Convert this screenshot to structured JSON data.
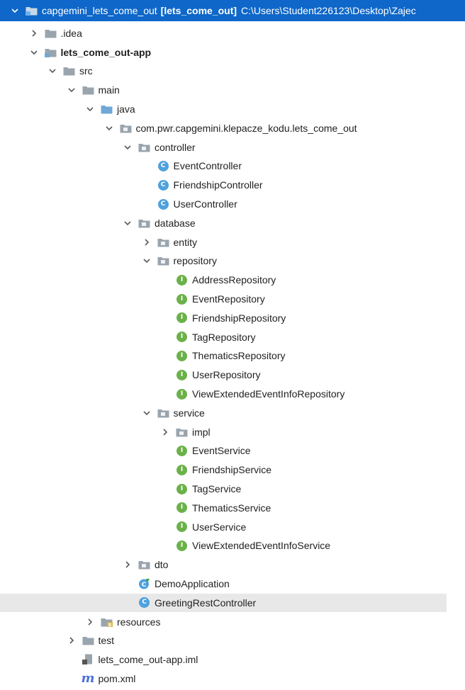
{
  "colors": {
    "selection": "#0e67c9",
    "folder": "#9aa4ad",
    "source_folder": "#6fa8d8",
    "class_badge": "#4ea1de",
    "interface_badge": "#6bb149",
    "maven": "#4a72d8"
  },
  "tree": [
    {
      "label": "capgemini_lets_come_out",
      "extra": "[lets_come_out]",
      "path": "C:\\Users\\Student226123\\Desktop\\Zajec",
      "icon": "project-module-icon",
      "chevron": "expanded",
      "depth": 0,
      "selected": true,
      "bold": false,
      "name": "tree-item-capgemini-lets-come-out"
    },
    {
      "label": ".idea",
      "icon": "folder-icon",
      "chevron": "collapsed",
      "depth": 1,
      "name": "tree-item-idea"
    },
    {
      "label": "lets_come_out-app",
      "icon": "module-folder-icon",
      "chevron": "expanded",
      "depth": 1,
      "bold": true,
      "name": "tree-item-lets-come-out-app"
    },
    {
      "label": "src",
      "icon": "folder-icon",
      "chevron": "expanded",
      "depth": 2,
      "name": "tree-item-src"
    },
    {
      "label": "main",
      "icon": "folder-icon",
      "chevron": "expanded",
      "depth": 3,
      "name": "tree-item-main"
    },
    {
      "label": "java",
      "icon": "source-folder-icon",
      "chevron": "expanded",
      "depth": 4,
      "name": "tree-item-java"
    },
    {
      "label": "com.pwr.capgemini.klepacze_kodu.lets_come_out",
      "icon": "package-icon",
      "chevron": "expanded",
      "depth": 5,
      "name": "tree-item-root-package"
    },
    {
      "label": "controller",
      "icon": "package-icon",
      "chevron": "expanded",
      "depth": 6,
      "name": "tree-item-controller"
    },
    {
      "label": "EventController",
      "icon": "class-icon",
      "chevron": "none",
      "depth": 7,
      "name": "tree-item-event-controller"
    },
    {
      "label": "FriendshipController",
      "icon": "class-icon",
      "chevron": "none",
      "depth": 7,
      "name": "tree-item-friendship-controller"
    },
    {
      "label": "UserController",
      "icon": "class-icon",
      "chevron": "none",
      "depth": 7,
      "name": "tree-item-user-controller"
    },
    {
      "label": "database",
      "icon": "package-icon",
      "chevron": "expanded",
      "depth": 6,
      "name": "tree-item-database"
    },
    {
      "label": "entity",
      "icon": "package-icon",
      "chevron": "collapsed",
      "depth": 7,
      "name": "tree-item-entity"
    },
    {
      "label": "repository",
      "icon": "package-icon",
      "chevron": "expanded",
      "depth": 7,
      "name": "tree-item-repository"
    },
    {
      "label": "AddressRepository",
      "icon": "interface-icon",
      "chevron": "none",
      "depth": 8,
      "name": "tree-item-address-repository"
    },
    {
      "label": "EventRepository",
      "icon": "interface-icon",
      "chevron": "none",
      "depth": 8,
      "name": "tree-item-event-repository"
    },
    {
      "label": "FriendshipRepository",
      "icon": "interface-icon",
      "chevron": "none",
      "depth": 8,
      "name": "tree-item-friendship-repository"
    },
    {
      "label": "TagRepository",
      "icon": "interface-icon",
      "chevron": "none",
      "depth": 8,
      "name": "tree-item-tag-repository"
    },
    {
      "label": "ThematicsRepository",
      "icon": "interface-icon",
      "chevron": "none",
      "depth": 8,
      "name": "tree-item-thematics-repository"
    },
    {
      "label": "UserRepository",
      "icon": "interface-icon",
      "chevron": "none",
      "depth": 8,
      "name": "tree-item-user-repository"
    },
    {
      "label": "ViewExtendedEventInfoRepository",
      "icon": "interface-icon",
      "chevron": "none",
      "depth": 8,
      "name": "tree-item-view-extended-event-info-repository"
    },
    {
      "label": "service",
      "icon": "package-icon",
      "chevron": "expanded",
      "depth": 7,
      "name": "tree-item-service"
    },
    {
      "label": "impl",
      "icon": "package-icon",
      "chevron": "collapsed",
      "depth": 8,
      "name": "tree-item-impl"
    },
    {
      "label": "EventService",
      "icon": "interface-icon",
      "chevron": "none",
      "depth": 8,
      "name": "tree-item-event-service"
    },
    {
      "label": "FriendshipService",
      "icon": "interface-icon",
      "chevron": "none",
      "depth": 8,
      "name": "tree-item-friendship-service"
    },
    {
      "label": "TagService",
      "icon": "interface-icon",
      "chevron": "none",
      "depth": 8,
      "name": "tree-item-tag-service"
    },
    {
      "label": "ThematicsService",
      "icon": "interface-icon",
      "chevron": "none",
      "depth": 8,
      "name": "tree-item-thematics-service"
    },
    {
      "label": "UserService",
      "icon": "interface-icon",
      "chevron": "none",
      "depth": 8,
      "name": "tree-item-user-service"
    },
    {
      "label": "ViewExtendedEventInfoService",
      "icon": "interface-icon",
      "chevron": "none",
      "depth": 8,
      "name": "tree-item-view-extended-event-info-service"
    },
    {
      "label": "dto",
      "icon": "package-icon",
      "chevron": "collapsed",
      "depth": 6,
      "name": "tree-item-dto"
    },
    {
      "label": "DemoApplication",
      "icon": "spring-class-icon",
      "chevron": "none",
      "depth": 6,
      "name": "tree-item-demo-application"
    },
    {
      "label": "GreetingRestController",
      "icon": "class-icon",
      "chevron": "none",
      "depth": 6,
      "name": "tree-item-greeting-rest-controller"
    },
    {
      "label": "resources",
      "icon": "resources-folder-icon",
      "chevron": "collapsed",
      "depth": 4,
      "name": "tree-item-resources"
    },
    {
      "label": "test",
      "icon": "folder-icon",
      "chevron": "collapsed",
      "depth": 3,
      "name": "tree-item-test"
    },
    {
      "label": "lets_come_out-app.iml",
      "icon": "iml-file-icon",
      "chevron": "none",
      "depth": 3,
      "name": "tree-item-iml-file"
    },
    {
      "label": "pom.xml",
      "icon": "maven-icon",
      "chevron": "none",
      "depth": 3,
      "name": "tree-item-pom-xml"
    }
  ]
}
